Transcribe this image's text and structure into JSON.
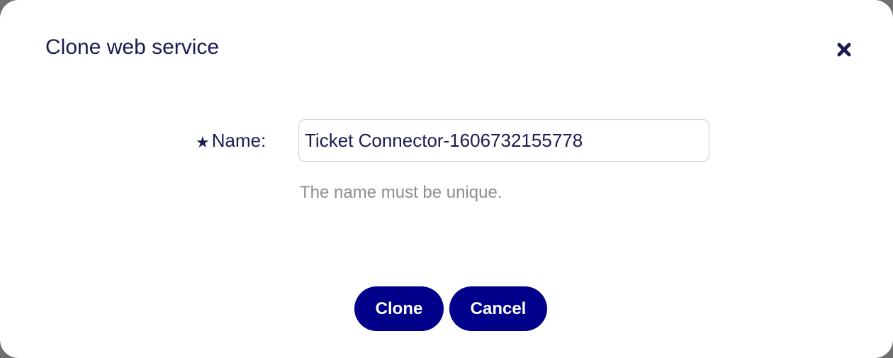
{
  "dialog": {
    "title": "Clone web service",
    "close_icon": "close-icon"
  },
  "form": {
    "required_marker": "★",
    "name_label": "Name:",
    "name_value": "Ticket Connector-1606732155778",
    "hint": "The name must be unique."
  },
  "actions": {
    "clone_label": "Clone",
    "cancel_label": "Cancel"
  },
  "colors": {
    "primary": "#00008b",
    "text": "#1b1b52",
    "hint": "#8d8d8d",
    "backdrop": "#6f6f6f"
  }
}
